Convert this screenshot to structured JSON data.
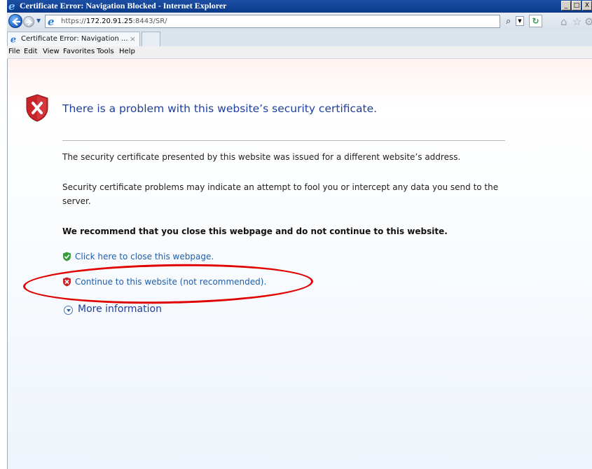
{
  "window": {
    "title": "Certificate Error: Navigation Blocked - Internet Explorer",
    "buttons": {
      "minimize": "_",
      "maximize": "□",
      "close": "X"
    }
  },
  "navbar": {
    "url_prefix": "https://",
    "url_host": "172.20.91.25",
    "url_rest": ":8443/SR/",
    "search_icon": "search-icon",
    "refresh_symbol": "↻"
  },
  "tabs": [
    {
      "title": "Certificate Error: Navigation ...",
      "close": "×"
    }
  ],
  "menu": [
    "File",
    "Edit",
    "View",
    "Favorites",
    "Tools",
    "Help"
  ],
  "page": {
    "heading": "There is a problem with this website’s security certificate.",
    "para1": "The security certificate presented by this website was issued for a different website’s address.",
    "para2_line1": "Security certificate problems may indicate an attempt to fool you or intercept any data you send to the",
    "para2_line2": "server.",
    "recommend": "We recommend that you close this webpage and do not continue to this website.",
    "close_link": "Click here to close this webpage.",
    "continue_link": "Continue to this website (not recommended).",
    "more_info": "More information"
  },
  "colors": {
    "heading": "#1f3f9e",
    "link": "#1e5da8",
    "annotation": "#e00000",
    "shield_red": "#c8252a",
    "shield_green": "#3a9b3f"
  }
}
